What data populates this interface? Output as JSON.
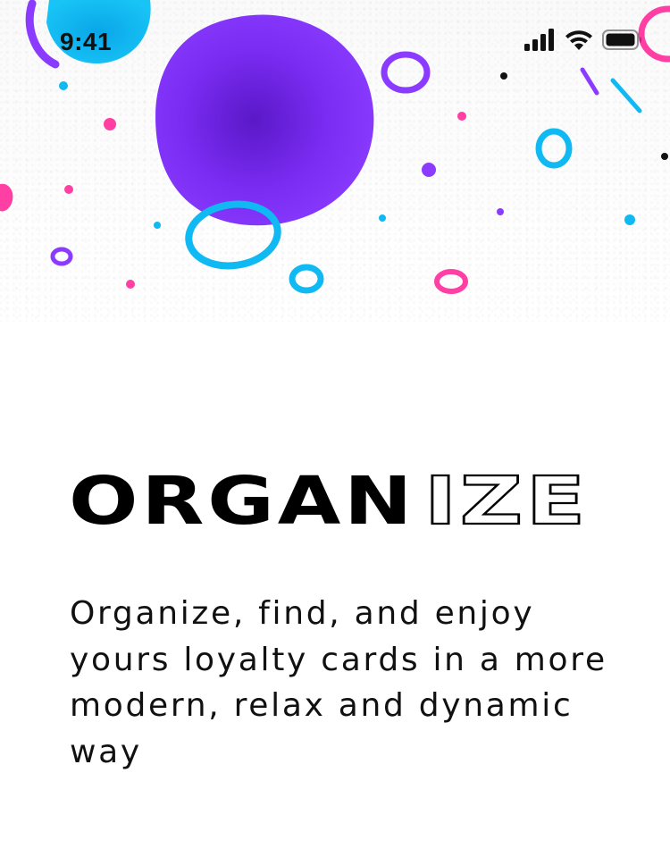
{
  "status_bar": {
    "time": "9:41",
    "icons": [
      "cellular-signal-icon",
      "wifi-icon",
      "battery-icon"
    ]
  },
  "hero": {
    "title_solid": "ORGAN",
    "title_outline": "IZE",
    "description": "Organize, find, and enjoy yours loyalty cards in a more modern, relax and dynamic way"
  },
  "colors": {
    "background": "#ffffff",
    "text": "#111111",
    "purple": "#7b2ff7",
    "cyan": "#10b9f2",
    "pink": "#ff3fa4"
  }
}
